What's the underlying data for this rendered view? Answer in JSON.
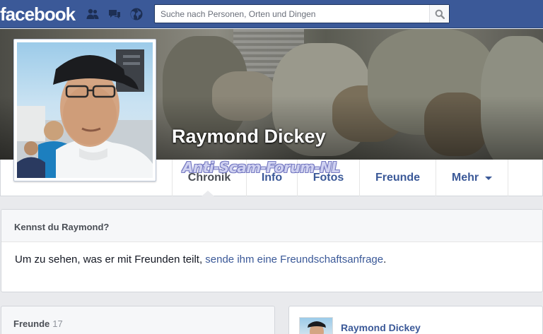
{
  "topbar": {
    "logo": "facebook",
    "search": {
      "placeholder": "Suche nach Personen, Orten und Dingen"
    }
  },
  "profile": {
    "name": "Raymond Dickey",
    "watermark": "Anti-Scam-Forum-NL"
  },
  "tabs": [
    {
      "label": "Chronik",
      "active": true
    },
    {
      "label": "Info"
    },
    {
      "label": "Fotos"
    },
    {
      "label": "Freunde"
    },
    {
      "label": "Mehr"
    }
  ],
  "know_card": {
    "title": "Kennst du Raymond?",
    "text": "Um zu sehen, was er mit Freunden teilt, ",
    "link": "sende ihm eine Freundschaftsanfrage",
    "suffix": "."
  },
  "friends_card": {
    "title": "Freunde",
    "count": "17"
  },
  "post_card": {
    "name": "Raymond Dickey"
  },
  "colors": {
    "brand": "#3b5998",
    "background": "#e9eaed",
    "text": "#141823"
  }
}
